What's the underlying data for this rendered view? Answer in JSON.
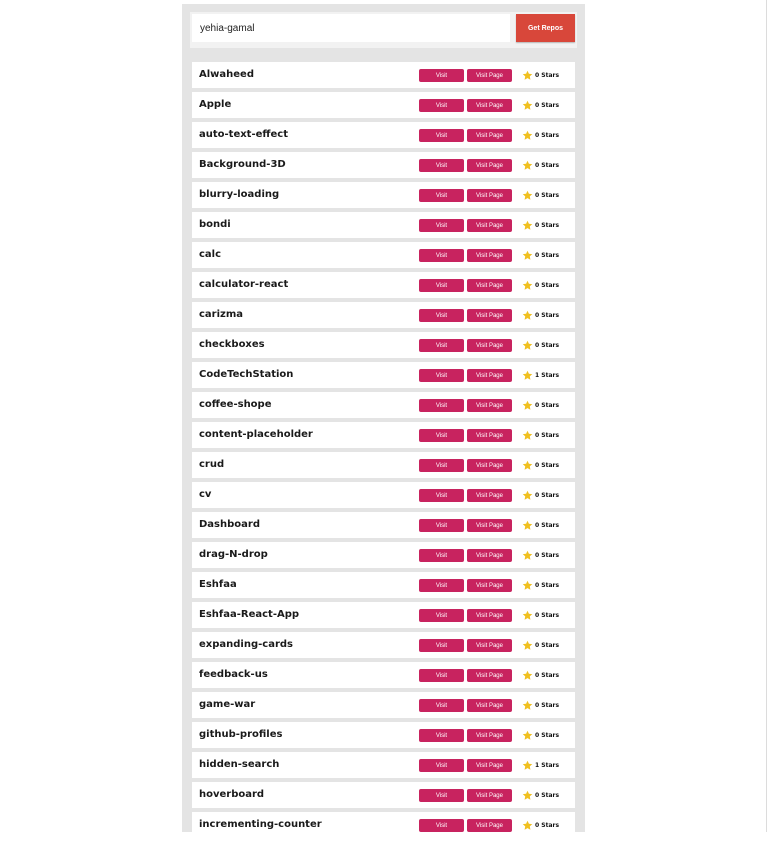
{
  "search": {
    "value": "yehia-gamal",
    "button_label": "Get Repos"
  },
  "repos": [
    {
      "name": "Alwaheed",
      "stars": "0 Stars"
    },
    {
      "name": "Apple",
      "stars": "0 Stars"
    },
    {
      "name": "auto-text-effect",
      "stars": "0 Stars"
    },
    {
      "name": "Background-3D",
      "stars": "0 Stars"
    },
    {
      "name": "blurry-loading",
      "stars": "0 Stars"
    },
    {
      "name": "bondi",
      "stars": "0 Stars"
    },
    {
      "name": "calc",
      "stars": "0 Stars"
    },
    {
      "name": "calculator-react",
      "stars": "0 Stars"
    },
    {
      "name": "carizma",
      "stars": "0 Stars"
    },
    {
      "name": "checkboxes",
      "stars": "0 Stars"
    },
    {
      "name": "CodeTechStation",
      "stars": "1 Stars"
    },
    {
      "name": "coffee-shope",
      "stars": "0 Stars"
    },
    {
      "name": "content-placeholder",
      "stars": "0 Stars"
    },
    {
      "name": "crud",
      "stars": "0 Stars"
    },
    {
      "name": "cv",
      "stars": "0 Stars"
    },
    {
      "name": "Dashboard",
      "stars": "0 Stars"
    },
    {
      "name": "drag-N-drop",
      "stars": "0 Stars"
    },
    {
      "name": "Eshfaa",
      "stars": "0 Stars"
    },
    {
      "name": "Eshfaa-React-App",
      "stars": "0 Stars"
    },
    {
      "name": "expanding-cards",
      "stars": "0 Stars"
    },
    {
      "name": "feedback-us",
      "stars": "0 Stars"
    },
    {
      "name": "game-war",
      "stars": "0 Stars"
    },
    {
      "name": "github-profiles",
      "stars": "0 Stars"
    },
    {
      "name": "hidden-search",
      "stars": "1 Stars"
    },
    {
      "name": "hoverboard",
      "stars": "0 Stars"
    },
    {
      "name": "incrementing-counter",
      "stars": "0 Stars"
    }
  ],
  "labels": {
    "visit": "Visit",
    "visit_page": "Visit Page"
  },
  "icons": {
    "star": "star-icon"
  },
  "colors": {
    "get_button": "#d8473a",
    "action_button": "#c8235f",
    "star": "#f0c020"
  }
}
